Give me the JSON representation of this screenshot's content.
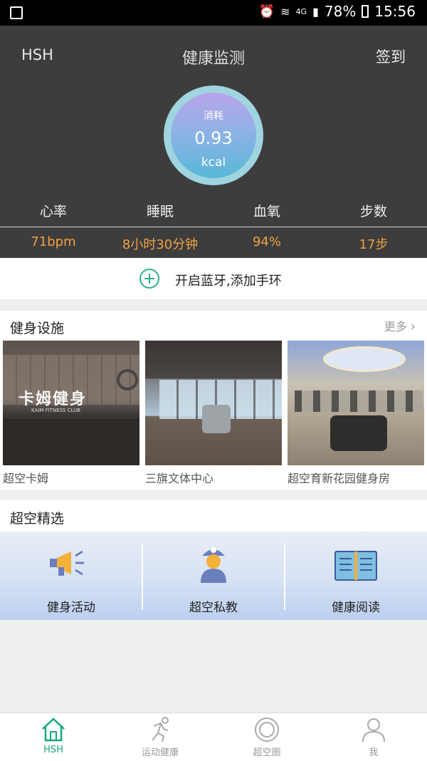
{
  "status_bar": {
    "battery": "78%",
    "time": "15:56",
    "network": "4G"
  },
  "header": {
    "left_label": "HSH",
    "title": "健康监测",
    "right_button": "签到"
  },
  "calorie": {
    "label": "消耗",
    "value": "0.93",
    "unit": "kcal"
  },
  "metrics": {
    "labels": [
      "心率",
      "睡眠",
      "血氧",
      "步数"
    ],
    "values": [
      "71bpm",
      "8小时30分钟",
      "94%",
      "17步"
    ]
  },
  "bluetooth": {
    "label": "开启蓝牙,添加手环"
  },
  "facilities": {
    "title": "健身设施",
    "more": "更多",
    "items": [
      {
        "name": "超空卡姆",
        "sign_text": "卡姆健身",
        "sign_sub": "KAIM FITNESS CLUB"
      },
      {
        "name": "三旗文体中心"
      },
      {
        "name": "超空育新花园健身房"
      }
    ]
  },
  "picks": {
    "title": "超空精选",
    "items": [
      {
        "label": "健身活动",
        "icon": "megaphone-icon"
      },
      {
        "label": "超空私教",
        "icon": "coach-icon"
      },
      {
        "label": "健康阅读",
        "icon": "book-icon"
      }
    ]
  },
  "tabbar": {
    "tabs": [
      {
        "label": "HSH",
        "icon": "home-icon",
        "active": true
      },
      {
        "label": "运动健康",
        "icon": "running-icon",
        "active": false
      },
      {
        "label": "超空圈",
        "icon": "circle-icon",
        "active": false
      },
      {
        "label": "我",
        "icon": "profile-icon",
        "active": false
      }
    ]
  },
  "colors": {
    "accent": "#17a77d",
    "metric_value": "#f0a143",
    "header_bg": "#3d3d3d"
  }
}
